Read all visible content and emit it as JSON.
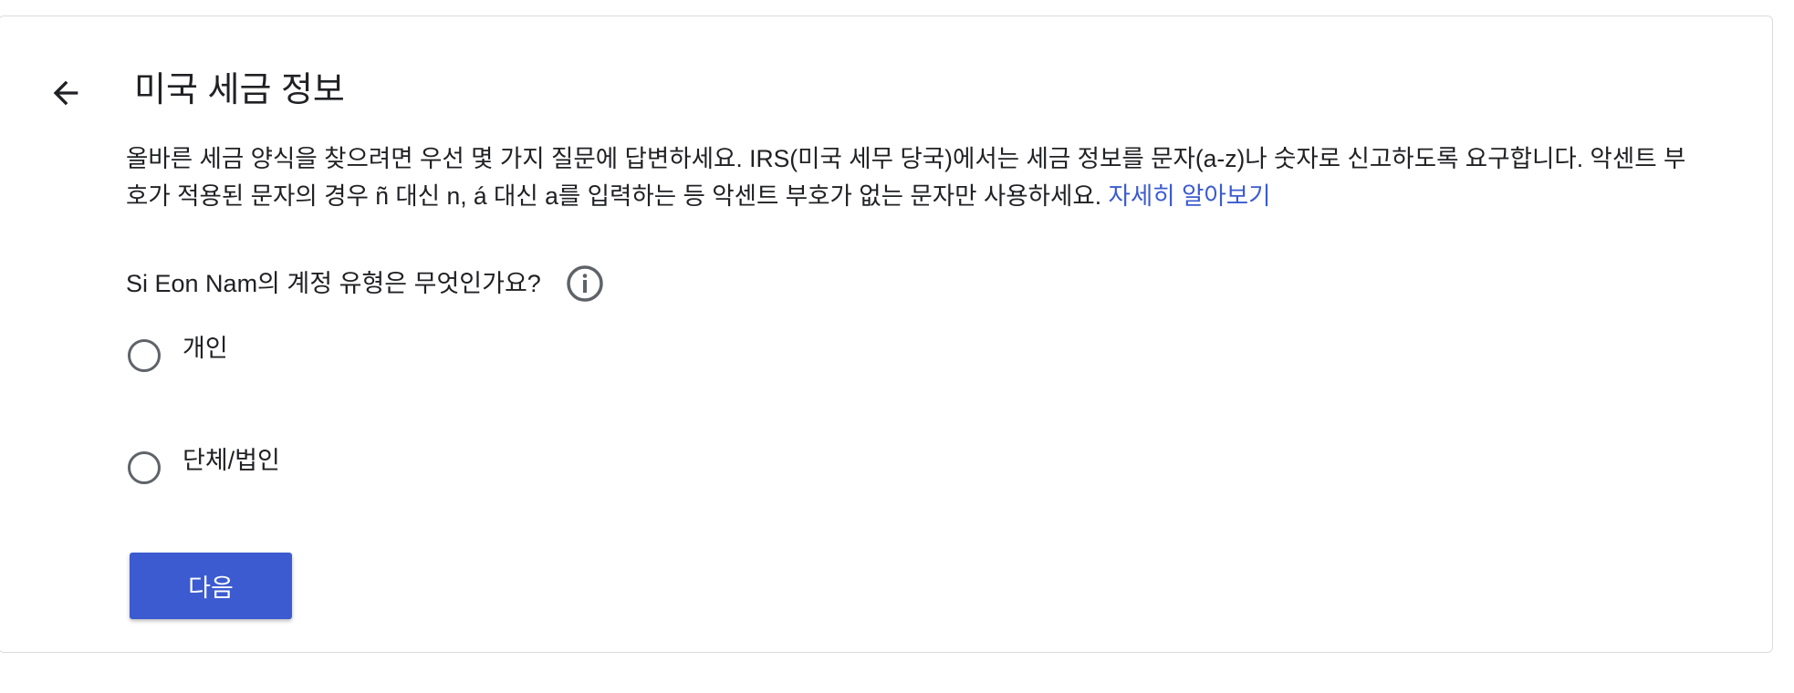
{
  "header": {
    "title": "미국 세금 정보",
    "back_icon": "arrow-back-icon"
  },
  "intro": {
    "text": "올바른 세금 양식을 찾으려면 우선 몇 가지 질문에 답변하세요. IRS(미국 세무 당국)에서는 세금 정보를 문자(a-z)나 숫자로 신고하도록 요구합니다. 악센트 부호가 적용된 문자의 경우 ñ 대신 n, á 대신 a를 입력하는 등 악센트 부호가 없는 문자만 사용하세요. ",
    "learn_more_link": "자세히 알아보기",
    "link_color": "#3c5bd0"
  },
  "question": {
    "text": "Si Eon Nam의 계정 유형은 무엇인가요?",
    "info_icon": "info-icon"
  },
  "options": [
    {
      "label": "개인",
      "selected": false
    },
    {
      "label": "단체/법인",
      "selected": false
    }
  ],
  "actions": {
    "next_label": "다음",
    "accent": "#3c5bd0"
  }
}
